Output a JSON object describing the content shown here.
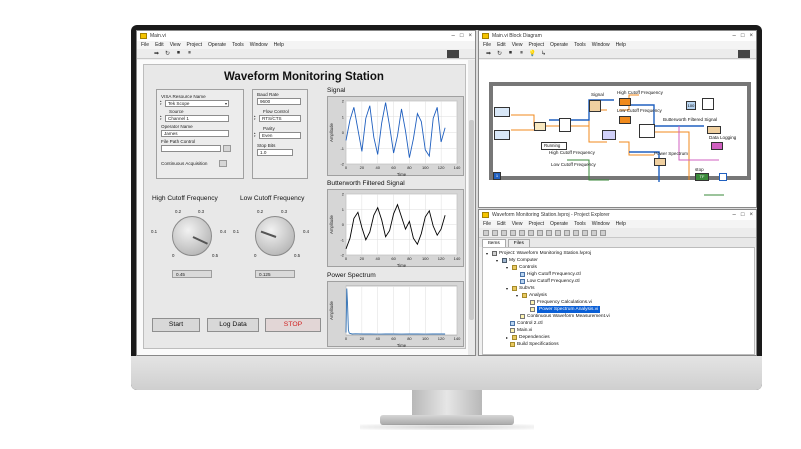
{
  "front_panel": {
    "window_title": "Main.vi",
    "menu": [
      "File",
      "Edit",
      "View",
      "Project",
      "Operate",
      "Tools",
      "Window",
      "Help"
    ],
    "app_title": "Waveform Monitoring Station",
    "visa_label": "VISA Resource Name",
    "visa_value": "Tek Scope",
    "source_label": "Source",
    "source_value": "Channel 1",
    "operator_label": "Operator Name",
    "operator_value": "James",
    "filepath_label": "File Path Control",
    "continuous_label": "Continuous Acquisition",
    "baud_label": "Baud Rate",
    "baud_value": "9600",
    "flow_label": "Flow Control",
    "flow_value": "RTS/CTS",
    "parity_label": "Parity",
    "parity_value": "Even",
    "stopbits_label": "Stop Bits",
    "stopbits_value": "1.0",
    "high_knob": {
      "title": "High Cutoff Frequency",
      "scale": [
        "0.1",
        "0.2",
        "0.3",
        "0.4",
        "0",
        "0.5"
      ],
      "value": 0.45,
      "display": "0.45"
    },
    "low_knob": {
      "title": "Low Cutoff Frequency",
      "scale": [
        "0.1",
        "0.2",
        "0.3",
        "0.4",
        "0",
        "0.5"
      ],
      "value": 0.125,
      "display": "0.125"
    },
    "buttons": {
      "start": "Start",
      "log": "Log Data",
      "stop": "STOP"
    },
    "colors": {
      "accent": "#2f6fb3",
      "stop_text": "#d12020"
    }
  },
  "chart_data": [
    {
      "type": "line",
      "title": "Signal",
      "xlabel": "Time",
      "ylabel": "Amplitude",
      "xlim": [
        0,
        140
      ],
      "ylim": [
        -2,
        2
      ],
      "xticks": [
        "0",
        "20",
        "40",
        "60",
        "80",
        "100",
        "120",
        "140"
      ],
      "yticks": [
        "2",
        "1",
        "0",
        "-1",
        "-2"
      ],
      "grid": true,
      "series": [
        {
          "color": "#1f5fbf",
          "x": [
            0,
            5,
            10,
            15,
            20,
            25,
            30,
            35,
            40,
            45,
            50,
            55,
            60,
            65,
            70,
            75,
            80,
            85,
            90,
            95,
            100,
            105,
            110,
            115,
            120,
            125
          ],
          "y": [
            -0.5,
            0.8,
            1.6,
            0.2,
            -1.2,
            0.9,
            1.7,
            -0.3,
            -1.4,
            0.6,
            1.9,
            0.4,
            -1.3,
            -0.2,
            1.5,
            0.1,
            -1.6,
            -0.4,
            1.2,
            0.7,
            -1.1,
            -1.5,
            0.9,
            1.6,
            -0.6,
            0.3
          ]
        }
      ]
    },
    {
      "type": "line",
      "title": "Butterworth Filtered Signal",
      "xlabel": "Time",
      "ylabel": "Amplitude",
      "xlim": [
        0,
        140
      ],
      "ylim": [
        -2,
        2
      ],
      "xticks": [
        "0",
        "20",
        "40",
        "60",
        "80",
        "100",
        "120",
        "140"
      ],
      "yticks": [
        "2",
        "1",
        "0",
        "-1",
        "-2"
      ],
      "grid": true,
      "series": [
        {
          "color": "#000000",
          "x": [
            0,
            5,
            10,
            15,
            20,
            25,
            30,
            35,
            40,
            45,
            50,
            55,
            60,
            65,
            70,
            75,
            80,
            85,
            90,
            95,
            100,
            105,
            110,
            115,
            120,
            125
          ],
          "y": [
            -1.6,
            -0.9,
            0.4,
            0.8,
            -0.2,
            -1.0,
            -0.5,
            0.6,
            1.1,
            0.3,
            -0.8,
            -0.4,
            0.7,
            1.3,
            0.5,
            -0.3,
            0.2,
            -0.9,
            -1.3,
            -0.6,
            0.5,
            0.9,
            -0.1,
            -0.7,
            -0.3,
            0.6
          ]
        }
      ]
    },
    {
      "type": "line",
      "title": "Power Spectrum",
      "xlabel": "Time",
      "ylabel": "Amplitude",
      "xlim": [
        0,
        140
      ],
      "ylim": [
        0,
        1
      ],
      "xticks": [
        "0",
        "20",
        "40",
        "60",
        "80",
        "100",
        "120",
        "140"
      ],
      "yticks": [],
      "grid": true,
      "series": [
        {
          "color": "#2f6fb3",
          "x": [
            0,
            1,
            2,
            3,
            4,
            5,
            8,
            12,
            20,
            30,
            40,
            50,
            60,
            70,
            80,
            90,
            100,
            110,
            120,
            125
          ],
          "y": [
            0.05,
            0.95,
            0.6,
            0.1,
            0.04,
            0.03,
            0.02,
            0.025,
            0.02,
            0.02,
            0.018,
            0.02,
            0.02,
            0.018,
            0.02,
            0.02,
            0.018,
            0.02,
            0.02,
            0.02
          ]
        }
      ]
    }
  ],
  "block_diagram": {
    "window_title": "Main.vi Block Diagram",
    "menu": [
      "File",
      "Edit",
      "View",
      "Project",
      "Operate",
      "Tools",
      "Window",
      "Help"
    ],
    "labels": {
      "signal": "Signal",
      "high1": "High Cutoff Frequency",
      "low1": "Low Cutoff Frequency",
      "high2": "High Cutoff Frequency",
      "low2": "Low Cutoff Frequency",
      "butterworth": "Butterworth Filtered Signal",
      "datalog": "Data Logging",
      "power": "Power Spectrum",
      "stop": "stop",
      "running": "Running",
      "const100": "100",
      "tf": "TF",
      "loopnum": "1"
    }
  },
  "project": {
    "window_title": "Waveform Monitoring Station.lvproj - Project Explorer",
    "menu": [
      "File",
      "Edit",
      "View",
      "Project",
      "Operate",
      "Tools",
      "Window",
      "Help"
    ],
    "tabs": [
      "Items",
      "Files"
    ],
    "tree": [
      {
        "label": "Project: Waveform Monitoring Station.lvproj",
        "icon": "proj",
        "expand": "▾"
      },
      {
        "label": "My Computer",
        "icon": "pc",
        "expand": "▾"
      },
      {
        "label": "Controls",
        "icon": "folder",
        "expand": "▾"
      },
      {
        "label": "High Cutoff Frequency.ctl",
        "icon": "ctl",
        "expand": ""
      },
      {
        "label": "Low Cutoff Frequency.ctl",
        "icon": "ctl",
        "expand": ""
      },
      {
        "label": "SubVIs",
        "icon": "folder",
        "expand": "▾"
      },
      {
        "label": "Analysis",
        "icon": "folder",
        "expand": "▾"
      },
      {
        "label": "Frequency Calculations.vi",
        "icon": "vi",
        "expand": ""
      },
      {
        "label": "Power Spectrum Analysis.vi",
        "icon": "vi",
        "expand": ""
      },
      {
        "label": "Continuous Waveform Measurement.vi",
        "icon": "vi",
        "expand": ""
      },
      {
        "label": "Control 2.ctl",
        "icon": "ctl",
        "expand": ""
      },
      {
        "label": "Main.vi",
        "icon": "vi",
        "expand": ""
      },
      {
        "label": "Dependencies",
        "icon": "folder",
        "expand": "▸"
      },
      {
        "label": "Build Specifications",
        "icon": "folder",
        "expand": ""
      }
    ]
  }
}
